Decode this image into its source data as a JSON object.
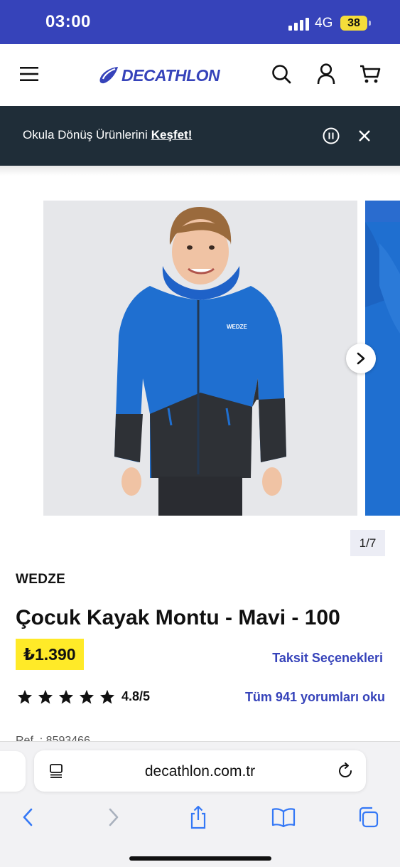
{
  "status_bar": {
    "time": "03:00",
    "network": "4G",
    "battery": "38"
  },
  "header": {
    "logo_text": "DECATHLON",
    "icons": [
      "menu-icon",
      "search-icon",
      "account-icon",
      "cart-icon"
    ]
  },
  "promo": {
    "text": "Okula Dönüş Ürünlerini",
    "link": "Keşfet!"
  },
  "gallery": {
    "counter": "1/7",
    "jacket_print": "WEDZE"
  },
  "product": {
    "brand": "WEDZE",
    "title": "Çocuk Kayak Montu - Mavi - 100",
    "price": "₺1.390",
    "installment_link": "Taksit Seçenekleri",
    "rating": "4.8/5",
    "stars": 5,
    "reviews_link": "Tüm 941 yorumları oku",
    "ref": "Ref. : 8593466"
  },
  "browser": {
    "url": "decathlon.com.tr"
  },
  "colors": {
    "brand_blue": "#3643ba",
    "banner_dark": "#1f2d38",
    "price_yellow": "#ffea28"
  }
}
